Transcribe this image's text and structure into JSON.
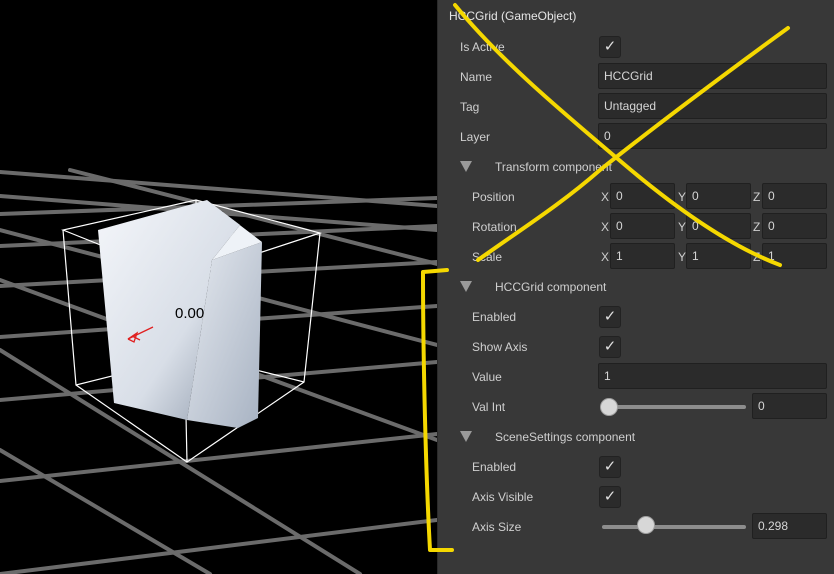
{
  "scene": {
    "cube_label": "0.00"
  },
  "inspector": {
    "title": "HCCGrid (GameObject)",
    "game_object": {
      "is_active_label": "Is Active",
      "is_active": true,
      "name_label": "Name",
      "name_value": "HCCGrid",
      "tag_label": "Tag",
      "tag_value": "Untagged",
      "layer_label": "Layer",
      "layer_value": "0"
    },
    "transform": {
      "header": "Transform component",
      "position_label": "Position",
      "rotation_label": "Rotation",
      "scale_label": "Scale",
      "axis_x": "X",
      "axis_y": "Y",
      "axis_z": "Z",
      "position": [
        "0",
        "0",
        "0"
      ],
      "rotation": [
        "0",
        "0",
        "0"
      ],
      "scale": [
        "1",
        "1",
        "1"
      ]
    },
    "hccgrid": {
      "header": "HCCGrid component",
      "enabled_label": "Enabled",
      "enabled": true,
      "show_axis_label": "Show Axis",
      "show_axis": true,
      "value_label": "Value",
      "value": "1",
      "val_int_label": "Val Int",
      "val_int": "0",
      "val_int_fraction": 0.0
    },
    "scene_settings": {
      "header": "SceneSettings component",
      "enabled_label": "Enabled",
      "enabled": true,
      "axis_visible_label": "Axis Visible",
      "axis_visible": true,
      "axis_size_label": "Axis Size",
      "axis_size": "0.298",
      "axis_size_fraction": 0.3
    },
    "check_glyph": "✓"
  },
  "annotation_colors": {
    "ink": "#f5d800"
  },
  "icons": {
    "foldout": "triangle-down-icon",
    "check": "checkmark-icon"
  }
}
